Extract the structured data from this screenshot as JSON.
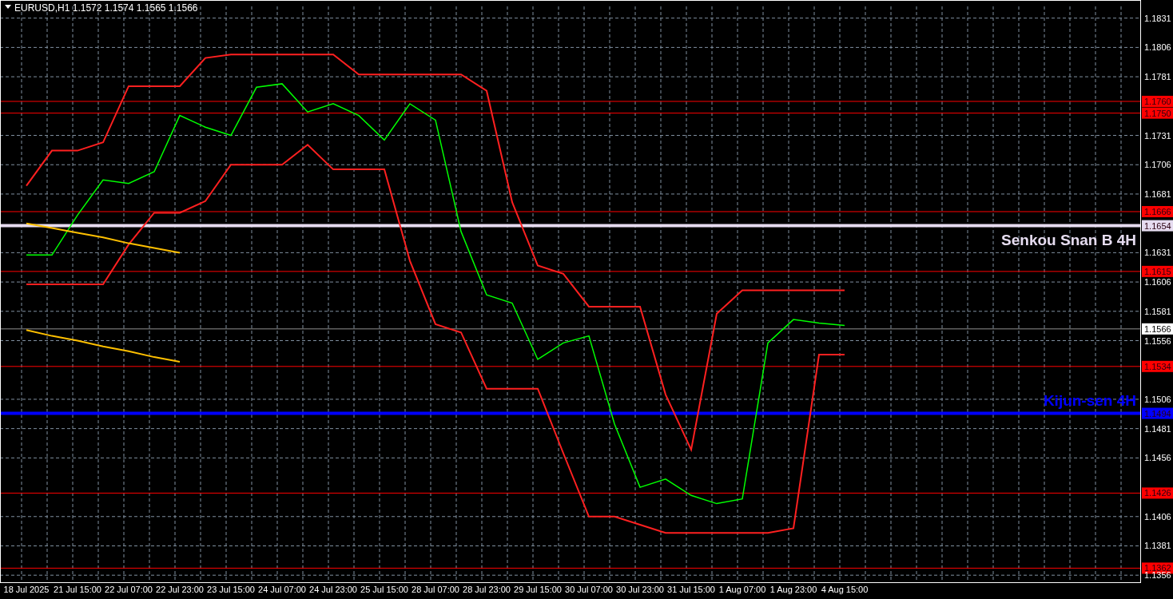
{
  "chart_header": {
    "symbol": "EURUSD,H1",
    "quote": "1.1572 1.1574 1.1565 1.1566"
  },
  "chart": {
    "chart_data": {
      "type": "line",
      "grid": true,
      "categories": [
        "18 Jul 2025",
        null,
        "21 Jul 15:00",
        null,
        "22 Jul 07:00",
        null,
        "22 Jul 23:00",
        null,
        "23 Jul 15:00",
        null,
        "24 Jul 07:00",
        null,
        "24 Jul 23:00",
        null,
        "25 Jul 15:00",
        null,
        "28 Jul 07:00",
        null,
        "28 Jul 23:00",
        null,
        "29 Jul 15:00",
        null,
        "30 Jul 07:00",
        null,
        "30 Jul 23:00",
        null,
        "31 Jul 15:00",
        null,
        "1 Aug 07:00",
        null,
        "1 Aug 23:00",
        null,
        "4 Aug 15:00"
      ],
      "series": [
        {
          "color": "#00ff00",
          "values": [
            1.1629,
            1.1629,
            1.1663,
            1.1693,
            1.169,
            1.17,
            1.1748,
            1.1738,
            1.1731,
            1.1772,
            1.1775,
            1.1751,
            1.1758,
            1.1748,
            1.1727,
            1.1758,
            1.1744,
            1.1649,
            1.1595,
            1.1588,
            1.154,
            1.1554,
            1.156,
            1.1485,
            1.1431,
            1.1438,
            1.1424,
            1.1417,
            1.1421,
            1.1554,
            1.1574,
            1.1571,
            1.1569
          ]
        },
        {
          "color": "#ff2020",
          "values": [
            1.1688,
            1.1718,
            1.1718,
            1.1725,
            1.1773,
            1.1773,
            1.1773,
            1.1797,
            1.18,
            1.18,
            1.18,
            1.18,
            1.18,
            1.1783,
            1.1783,
            1.1783,
            1.1783,
            1.1783,
            1.1769,
            1.1674,
            1.162,
            1.1613,
            1.1585,
            1.1585,
            1.1585,
            1.151,
            1.1463,
            1.1579,
            1.1599,
            1.1599,
            1.1599,
            1.1599,
            1.1599
          ]
        },
        {
          "color": "#ff2020",
          "values": [
            1.1604,
            1.1604,
            1.1604,
            1.1604,
            1.1638,
            1.1665,
            1.1665,
            1.1675,
            1.1706,
            1.1706,
            1.1706,
            1.1723,
            1.1702,
            1.1702,
            1.1702,
            1.1624,
            1.157,
            1.1563,
            1.1515,
            1.1515,
            1.1515,
            1.146,
            1.1406,
            1.1406,
            1.1399,
            1.1392,
            1.1392,
            1.1392,
            1.1392,
            1.1392,
            1.1396,
            1.1544,
            1.1544
          ]
        },
        {
          "color": "#ffc000",
          "values": [
            1.1656,
            1.1652,
            1.1648,
            1.1644,
            1.1639,
            1.1635,
            1.1631,
            null,
            null,
            null,
            null,
            null,
            null,
            null,
            null,
            null,
            null,
            null,
            null,
            null,
            null,
            null,
            null,
            null,
            null,
            null,
            null,
            null,
            null,
            null,
            null,
            null,
            null
          ]
        },
        {
          "color": "#ffc000",
          "values": [
            1.1565,
            1.156,
            1.1556,
            1.1551,
            1.1547,
            1.1542,
            1.1538,
            null,
            null,
            null,
            null,
            null,
            null,
            null,
            null,
            null,
            null,
            null,
            null,
            null,
            null,
            null,
            null,
            null,
            null,
            null,
            null,
            null,
            null,
            null,
            null,
            null,
            null
          ]
        }
      ],
      "ylim": [
        1.135,
        1.1841
      ],
      "yticks": [
        {
          "value": 1.1831,
          "label": "1.1831"
        },
        {
          "value": 1.1806,
          "label": "1.1806"
        },
        {
          "value": 1.1781,
          "label": "1.1781"
        },
        {
          "value": 1.1731,
          "label": "1.1731"
        },
        {
          "value": 1.1706,
          "label": "1.1706"
        },
        {
          "value": 1.1681,
          "label": "1.1681"
        },
        {
          "value": 1.1631,
          "label": "1.1631"
        },
        {
          "value": 1.1606,
          "label": "1.1606"
        },
        {
          "value": 1.1581,
          "label": "1.1581"
        },
        {
          "value": 1.1556,
          "label": "1.1556"
        },
        {
          "value": 1.1506,
          "label": "1.1506"
        },
        {
          "value": 1.1481,
          "label": "1.1481"
        },
        {
          "value": 1.1456,
          "label": "1.1456"
        },
        {
          "value": 1.1406,
          "label": "1.1406"
        },
        {
          "value": 1.1381,
          "label": "1.1381"
        },
        {
          "value": 1.1356,
          "label": "1.1356"
        }
      ],
      "ref_lines": [
        {
          "axis": "y",
          "value": 1.176,
          "label": "1.1760",
          "color": "#ff0000"
        },
        {
          "axis": "y",
          "value": 1.175,
          "label": "1.1750",
          "color": "#ff0000"
        },
        {
          "axis": "y",
          "value": 1.1666,
          "label": "1.1666",
          "color": "#ff0000"
        },
        {
          "axis": "y",
          "value": 1.1654,
          "label": "1.1654",
          "color": "#e6dcf0"
        },
        {
          "axis": "y",
          "value": 1.1654,
          "label": "Senkou Snan B 4H",
          "color": "#e6dcf0"
        },
        {
          "axis": "y",
          "value": 1.1615,
          "label": "1.1615",
          "color": "#ff0000"
        },
        {
          "axis": "y",
          "value": 1.1566,
          "label": "1.1566",
          "color": "#909090"
        },
        {
          "axis": "y",
          "value": 1.1534,
          "label": "1.1534",
          "color": "#ff0000"
        },
        {
          "axis": "y",
          "value": 1.1494,
          "label": "1.1494",
          "color": "#0000ff"
        },
        {
          "axis": "y",
          "value": 1.1494,
          "label": "Kijun-sen 4H",
          "color": "#0000ff"
        },
        {
          "axis": "y",
          "value": 1.1426,
          "label": "1.1426",
          "color": "#ff0000"
        },
        {
          "axis": "y",
          "value": 1.1362,
          "label": "1.1362",
          "color": "#ff0000"
        }
      ]
    }
  }
}
